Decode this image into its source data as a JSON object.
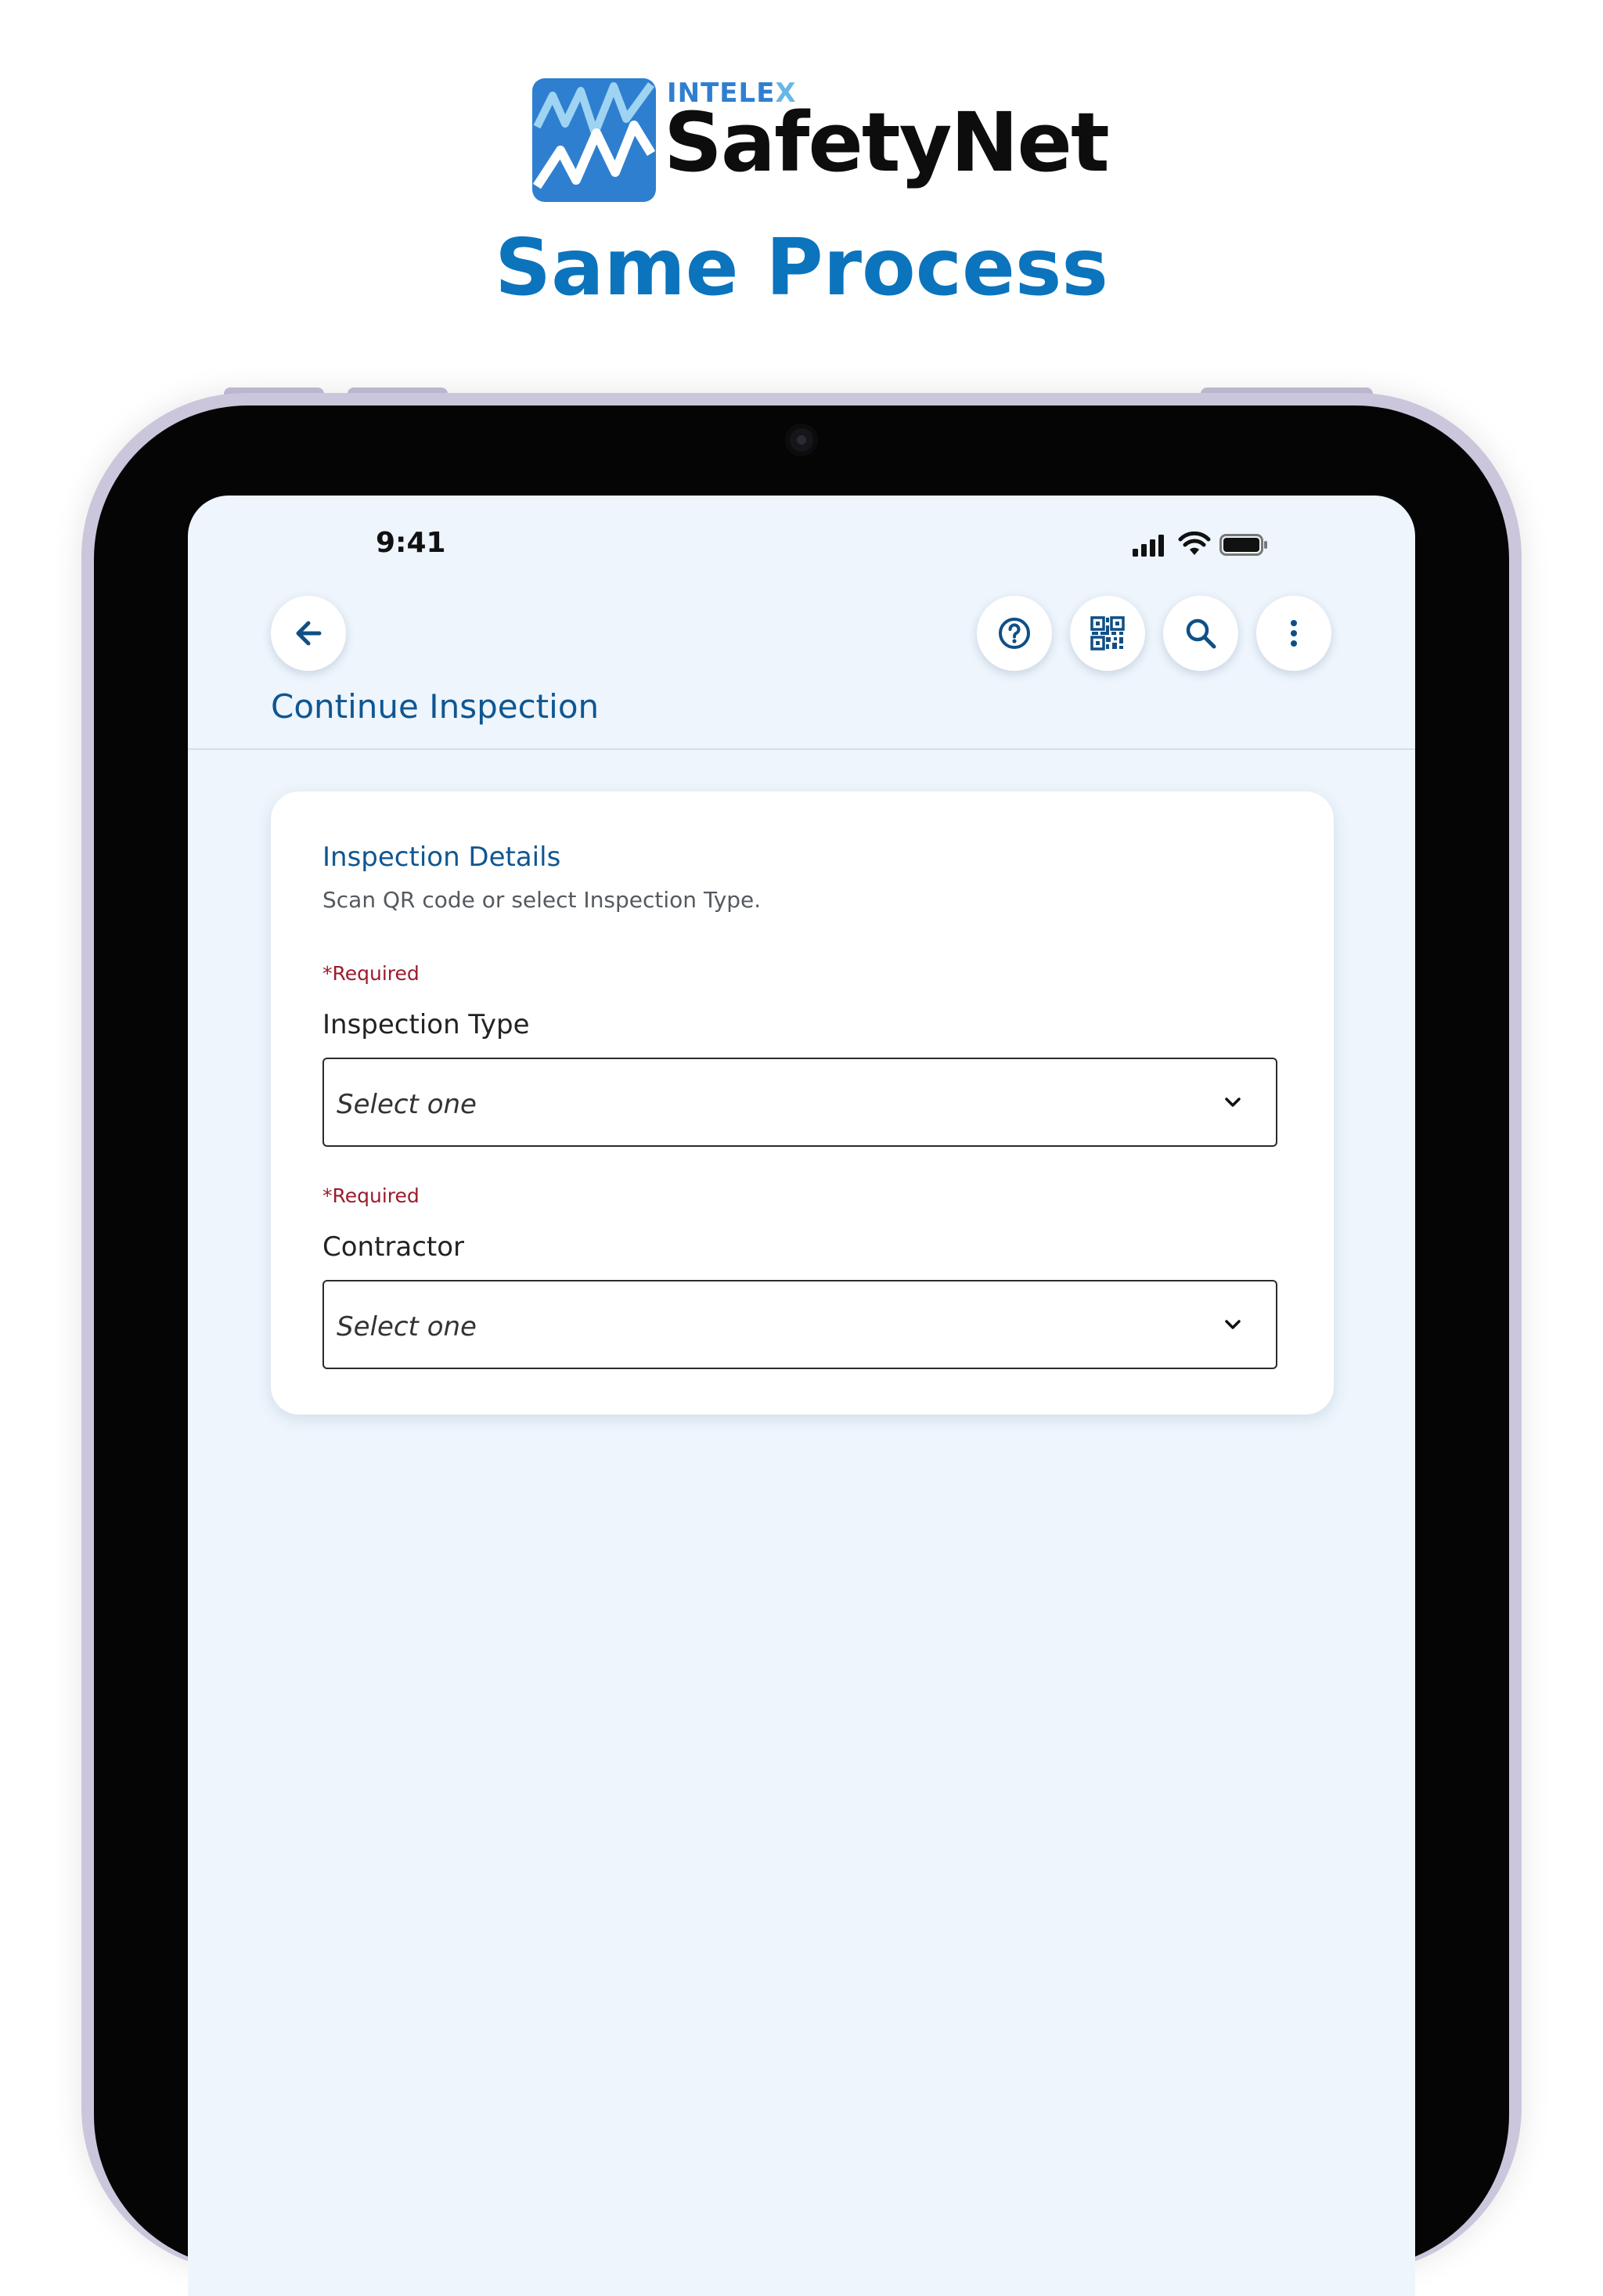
{
  "branding": {
    "company": "INTELE",
    "company_x": "X",
    "product": "SafetyNet",
    "headline": "Same Process",
    "colors": {
      "brand_blue": "#0b74bd",
      "logo_blue": "#2f7fd0",
      "logo_light_blue": "#69b6e6"
    }
  },
  "status_bar": {
    "time": "9:41",
    "icons": [
      "cellular-signal-icon",
      "wifi-icon",
      "battery-icon"
    ]
  },
  "toolbar": {
    "back_icon": "arrow-left-icon",
    "actions": [
      {
        "icon": "help-circle-icon"
      },
      {
        "icon": "qr-code-icon"
      },
      {
        "icon": "search-icon"
      },
      {
        "icon": "more-vertical-icon"
      }
    ]
  },
  "page": {
    "title": "Continue Inspection"
  },
  "card": {
    "title": "Inspection Details",
    "subtitle": "Scan QR code or select Inspection Type.",
    "fields": [
      {
        "required_label": "*Required",
        "label": "Inspection Type",
        "value": "Select one"
      },
      {
        "required_label": "*Required",
        "label": "Contractor",
        "value": "Select one"
      }
    ]
  },
  "colors": {
    "title_blue": "#0f5692",
    "required_red": "#9b1c2c",
    "screen_background": "#eef5fc"
  }
}
